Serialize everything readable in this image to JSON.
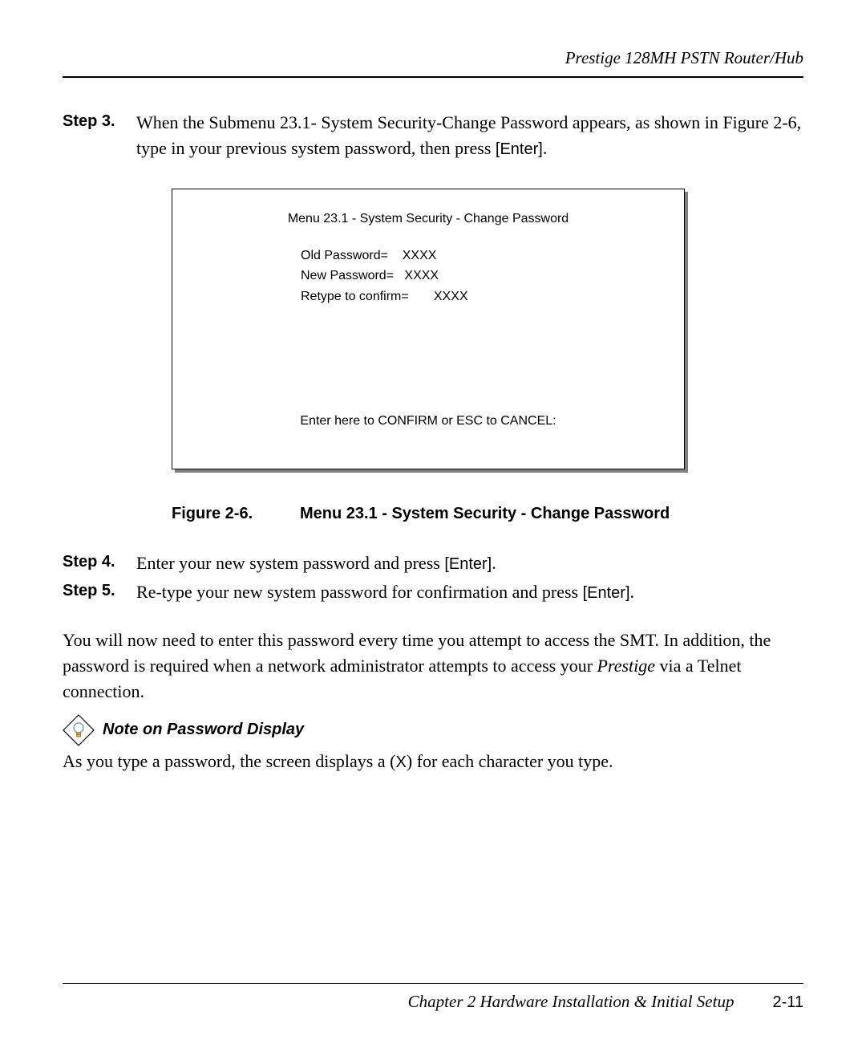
{
  "header": {
    "product": "Prestige 128MH   PSTN Router/Hub"
  },
  "steps": {
    "s3": {
      "label": "Step 3.",
      "text_a": "When the Submenu 23.1- System Security-Change Password appears, as shown in Figure 2-6, type in your previous system password, then press ",
      "key": "[Enter]",
      "text_b": "."
    },
    "s4": {
      "label": "Step 4.",
      "text_a": "Enter your new system password and press ",
      "key": "[Enter]",
      "text_b": "."
    },
    "s5": {
      "label": "Step 5.",
      "text_a": "Re-type your new system password for confirmation and press ",
      "key": "[Enter]",
      "text_b": "."
    }
  },
  "terminal": {
    "title": "Menu 23.1 - System Security - Change Password",
    "old_label": "Old Password=",
    "old_val": "XXXX",
    "new_label": "New Password=",
    "new_val": "XXXX",
    "retype_label": "Retype to confirm=",
    "retype_val": "XXXX",
    "footer": "Enter here to CONFIRM or ESC to CANCEL:"
  },
  "figure": {
    "label": "Figure 2-6.",
    "caption": "Menu 23.1 - System Security - Change Password"
  },
  "paragraph": {
    "text_a": "You will now need to enter this password every time you attempt to access the SMT. In addition, the password is required when a network administrator attempts to access your ",
    "em": "Prestige",
    "text_b": " via a Telnet connection."
  },
  "note": {
    "title": "Note on Password Display",
    "body_a": "As you type a password, the screen displays a (",
    "x": "X",
    "body_b": ") for each character you type."
  },
  "footer": {
    "chapter_label": "Chapter 2 ",
    "chapter_title": "Hardware Installation & Initial Setup",
    "page": "2-11"
  }
}
